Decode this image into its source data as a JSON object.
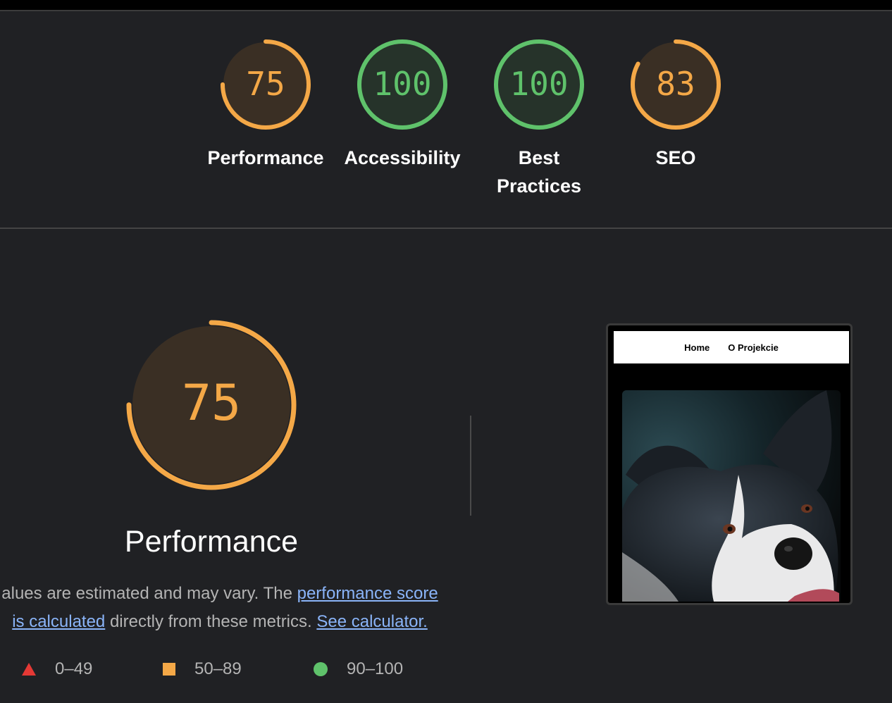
{
  "scores": [
    {
      "name": "Performance",
      "score": 75,
      "score_text": "75",
      "color": "#f4a847",
      "bg": "#3a2f24"
    },
    {
      "name": "Accessibility",
      "score": 100,
      "score_text": "100",
      "color": "#5fc26b",
      "bg": "#26332a"
    },
    {
      "name": "Best\nPractices",
      "score": 100,
      "score_text": "100",
      "color": "#5fc26b",
      "bg": "#26332a"
    },
    {
      "name": "SEO",
      "score": 83,
      "score_text": "83",
      "color": "#f4a847",
      "bg": "#3a2f24"
    }
  ],
  "performance": {
    "score": 75,
    "score_text": "75",
    "title": "Performance",
    "desc_prefix": "alues are estimated and may vary. The ",
    "link_score": "performance score",
    "link_calc": "is calculated",
    "desc_mid": " directly from these metrics. ",
    "link_see": "See calculator."
  },
  "legend": {
    "fail": {
      "range": "0–49",
      "color": "#e53935",
      "icon": "triangle-icon"
    },
    "average": {
      "range": "50–89",
      "color": "#f4a847",
      "icon": "square-icon"
    },
    "pass": {
      "range": "90–100",
      "color": "#5fc26b",
      "icon": "circle-icon"
    }
  },
  "preview": {
    "nav_home": "Home",
    "nav_project": "O Projekcie"
  }
}
